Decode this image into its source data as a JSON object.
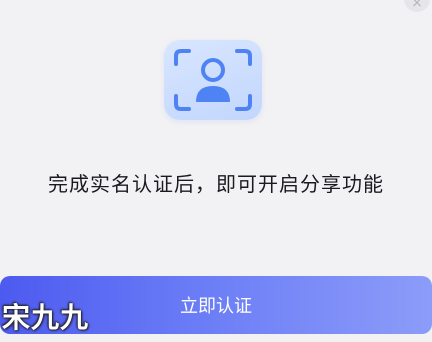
{
  "dialog": {
    "close_symbol": "×",
    "message": "完成实名认证后，即可开启分享功能",
    "verify_button_label": "立即认证",
    "watermark_text": "宋九九"
  },
  "colors": {
    "accent_start": "#4d5af0",
    "accent_end": "#8c9cf9",
    "icon_blue": "#4f83f4",
    "background": "#f2f2f4"
  },
  "icons": {
    "close": "close-icon",
    "identity": "person-scan-icon"
  }
}
